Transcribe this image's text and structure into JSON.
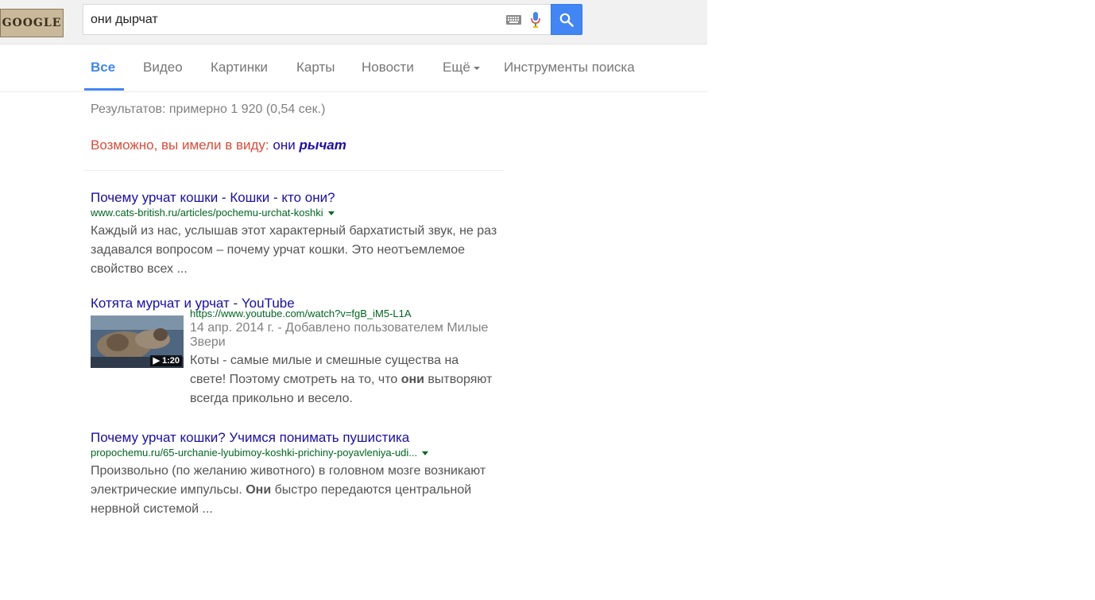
{
  "header": {
    "logo_text": "GOOGLE",
    "search_value": "они дырчат",
    "icons": {
      "keyboard": "keyboard-icon",
      "mic": "microphone-icon",
      "search": "search-icon"
    }
  },
  "tabs": {
    "items": [
      "Все",
      "Видео",
      "Картинки",
      "Карты",
      "Новости",
      "Ещё"
    ],
    "tools": "Инструменты поиска",
    "active_index": 0
  },
  "stats": "Результатов: примерно 1 920 (0,54 сек.)",
  "did_you_mean": {
    "prefix": "Возможно, вы имели в виду:",
    "plain": "они",
    "bold": "рычат"
  },
  "results": [
    {
      "title": "Почему урчат кошки - Кошки - кто они?",
      "url": "www.cats-british.ru/articles/pochemu-urchat-koshki",
      "snippet": "Каждый из нас, услышав этот характерный бархатистый звук, не раз задавался вопросом – почему урчат кошки. Это неотъемлемое свойство всех ..."
    },
    {
      "title": "Котята мурчат и урчат - YouTube",
      "url": "https://www.youtube.com/watch?v=fgB_iM5-L1A",
      "duration": "▶ 1:20",
      "meta": "14 апр. 2014 г. - Добавлено пользователем Милые Звери",
      "snippet_a": "Коты - самые милые и смешные существа на свете! Поэтому смотреть на то, что ",
      "snippet_bold": "они",
      "snippet_b": " вытворяют всегда прикольно и весело."
    },
    {
      "title": "Почему урчат кошки? Учимся понимать пушистика",
      "url": "propochemu.ru/65-urchanie-lyubimoy-koshki-prichiny-poyavleniya-udi...",
      "snippet_a": "Произвольно (по желанию животного) в головном мозге возникают электрические импульсы. ",
      "snippet_bold": "Они",
      "snippet_b": " быстро передаются центральной нервной системой ..."
    }
  ],
  "colors": {
    "accent": "#4285f4",
    "link": "#1a0dab",
    "url": "#006621",
    "dym": "#dd4b39"
  }
}
